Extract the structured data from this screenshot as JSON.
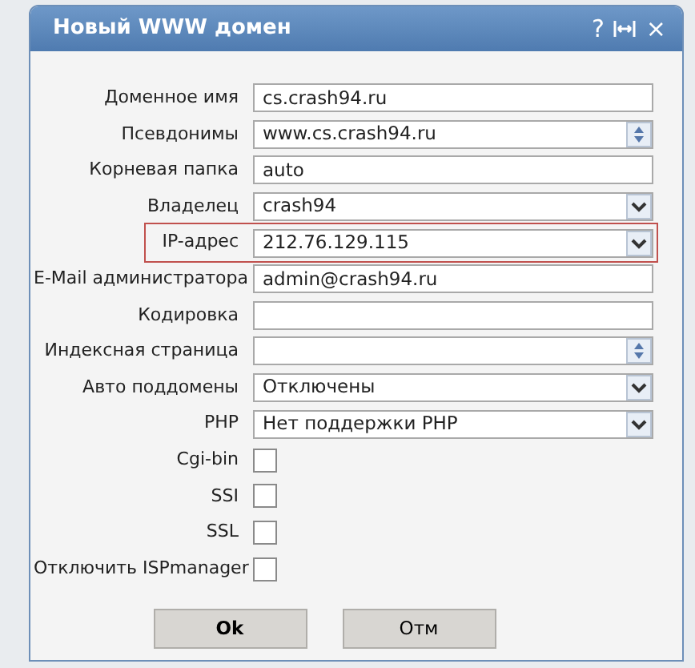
{
  "dialog": {
    "title": "Новый WWW домен",
    "title_buttons": [
      "?",
      "×"
    ]
  },
  "fields": [
    {
      "kind": "text",
      "label": "Доменное имя",
      "value": "cs.crash94.ru",
      "highlighted": false
    },
    {
      "kind": "spin",
      "label": "Псевдонимы",
      "value": "www.cs.crash94.ru",
      "highlighted": false
    },
    {
      "kind": "text",
      "label": "Корневая папка",
      "value": "auto",
      "highlighted": false
    },
    {
      "kind": "select",
      "label": "Владелец",
      "value": "crash94",
      "highlighted": false
    },
    {
      "kind": "select",
      "label": "IP-адрес",
      "value": "212.76.129.115",
      "highlighted": true
    },
    {
      "kind": "text",
      "label": "E-Mail администратора",
      "value": "admin@crash94.ru",
      "highlighted": false
    },
    {
      "kind": "text",
      "label": "Кодировка",
      "highlighted": false
    },
    {
      "kind": "spin",
      "label": "Индексная страница",
      "highlighted": false
    },
    {
      "kind": "select",
      "label": "Авто поддомены",
      "value": "Отключены",
      "highlighted": false
    },
    {
      "kind": "select",
      "label": "PHP",
      "value": "Нет поддержки PHP",
      "highlighted": false
    },
    {
      "kind": "checkbox",
      "label": "Cgi-bin",
      "checked": false
    },
    {
      "kind": "checkbox",
      "label": "SSI",
      "checked": false
    },
    {
      "kind": "checkbox",
      "label": "SSL",
      "checked": false
    },
    {
      "kind": "checkbox",
      "label": "Отключить ISPmanager",
      "checked": false
    }
  ],
  "buttons": [
    "Ok",
    "Отм"
  ]
}
